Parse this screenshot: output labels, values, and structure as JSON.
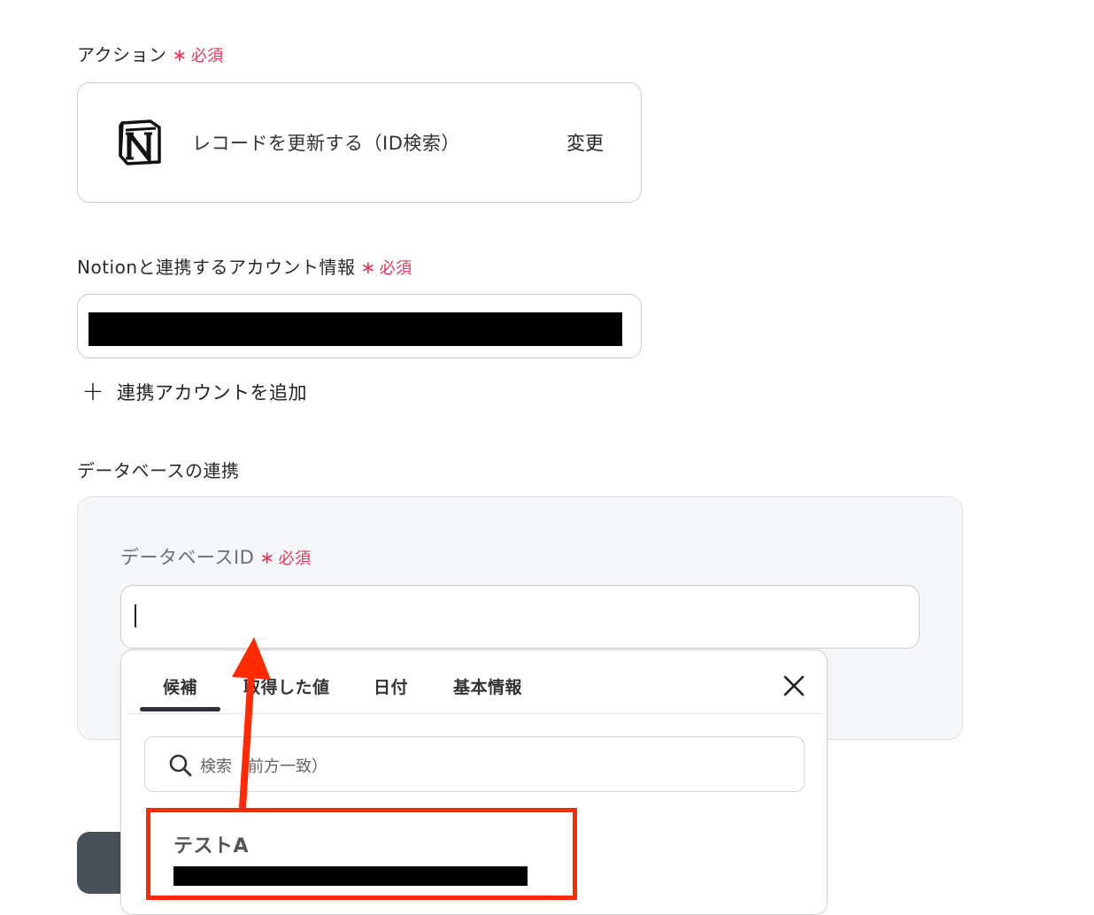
{
  "action": {
    "label": "アクション",
    "required": "必須",
    "required_mark": "∗",
    "value": "レコードを更新する（ID検索）",
    "change_label": "変更",
    "app_icon": "notion-logo-icon"
  },
  "account": {
    "label": "Notionと連携するアカウント情報",
    "required": "必須",
    "required_mark": "∗",
    "add_label": "連携アカウントを追加"
  },
  "database": {
    "section_title": "データベースの連携",
    "id_label": "データベースID",
    "required": "必須",
    "required_mark": "∗"
  },
  "dropdown": {
    "tabs": [
      {
        "label": "候補"
      },
      {
        "label": "取得した値"
      },
      {
        "label": "日付"
      },
      {
        "label": "基本情報"
      }
    ],
    "active_tab": 0,
    "search_placeholder": "検索（前方一致）",
    "results": [
      {
        "title": "テストA"
      }
    ]
  },
  "colors": {
    "required": "#e8365a",
    "highlight": "#ff2a00",
    "arrow": "#ff2a00"
  }
}
